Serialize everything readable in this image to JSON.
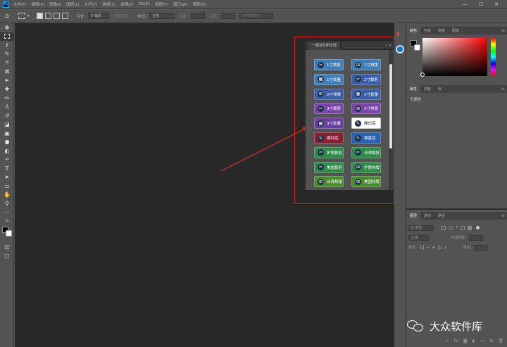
{
  "app": {
    "logo": "Ps"
  },
  "menu": [
    "文件(F)",
    "编辑(E)",
    "图像(I)",
    "图层(L)",
    "文字(Y)",
    "选择(S)",
    "滤镜(T)",
    "3D(D)",
    "视图(V)",
    "窗口(W)",
    "帮助(H)"
  ],
  "window_buttons": [
    "—",
    "☐",
    "✕"
  ],
  "options": {
    "feather_label": "羽化:",
    "feather_value": "0 像素",
    "antialias": "消除锯齿",
    "style_label": "样式:",
    "style_value": "正常",
    "width_label": "宽度:",
    "height_label": "高度:",
    "select_mask": "选择并遮住..."
  },
  "plugin": {
    "title": "一键证件照大师",
    "controls": "« ≡",
    "buttons": [
      {
        "label": "1寸裁剪",
        "icon": "scissors-icon",
        "color": "#3f7fb8"
      },
      {
        "label": "1寸排版",
        "icon": "grid-icon",
        "color": "#3f7fb8"
      },
      {
        "label": "1寸批量",
        "icon": "batch-icon",
        "color": "#3f7fb8"
      },
      {
        "label": "2寸裁剪",
        "icon": "scissors-icon",
        "color": "#3a5fa8"
      },
      {
        "label": "2寸排版",
        "icon": "grid-icon",
        "color": "#3a5fa8"
      },
      {
        "label": "2寸批量",
        "icon": "batch-icon",
        "color": "#3a5fa8"
      },
      {
        "label": "3寸裁剪",
        "icon": "scissors-icon",
        "color": "#7a45a8"
      },
      {
        "label": "3寸排版",
        "icon": "grid-icon",
        "color": "#7a45a8"
      },
      {
        "label": "3寸批量",
        "icon": "batch-icon",
        "color": "#6a40a0"
      },
      {
        "label": "换白底",
        "icon": "brush-icon",
        "color": "#ffffff"
      },
      {
        "label": "换红底",
        "icon": "brush-icon",
        "color": "#8a2035"
      },
      {
        "label": "换蓝底",
        "icon": "brush-icon",
        "color": "#2a63b0"
      },
      {
        "label": "护照裁剪",
        "icon": "scissors-icon",
        "color": "#2f8a4a"
      },
      {
        "label": "台湾裁剪",
        "icon": "scissors-icon",
        "color": "#2f8a4a"
      },
      {
        "label": "美国裁剪",
        "icon": "scissors-icon",
        "color": "#2f8a4a"
      },
      {
        "label": "护照排版",
        "icon": "grid-icon",
        "color": "#2f8a4a"
      },
      {
        "label": "台湾排版",
        "icon": "grid-icon",
        "color": "#4a8a30"
      },
      {
        "label": "美国排版",
        "icon": "grid-icon",
        "color": "#4a8a30"
      }
    ]
  },
  "right_panel": {
    "color_tabs": [
      "颜色",
      "色板",
      "渐变",
      "图案"
    ],
    "props_tabs": [
      "属性",
      "调整",
      "库"
    ],
    "props_empty": "无属性",
    "layers_tabs": [
      "图层",
      "通道",
      "路径"
    ],
    "layers_search": "Q 类型",
    "blend_mode": "正常",
    "opacity_label": "不透明度:",
    "lock_label": "锁定:",
    "fill_label": "填充:"
  },
  "watermark": {
    "text": "大众软件库"
  },
  "colors": {
    "annotation": "#dd2222"
  }
}
